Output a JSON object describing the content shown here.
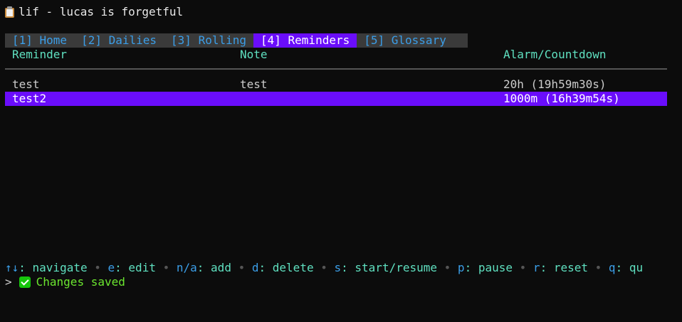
{
  "app": {
    "title": "lif - lucas is forgetful",
    "icon": "clipboard-icon"
  },
  "tabs": [
    {
      "label": "[1] Home",
      "active": false
    },
    {
      "label": "[2] Dailies",
      "active": false
    },
    {
      "label": "[3] Rolling",
      "active": false
    },
    {
      "label": "[4] Reminders",
      "active": true
    },
    {
      "label": "[5] Glossary",
      "active": false
    }
  ],
  "table": {
    "headers": {
      "reminder": "Reminder",
      "note": "Note",
      "alarm": "Alarm/Countdown"
    },
    "rows": [
      {
        "reminder": "test",
        "note": "test",
        "alarm": "20h (19h59m30s)",
        "selected": false
      },
      {
        "reminder": "test2",
        "note": "",
        "alarm": "1000m (16h39m54s)",
        "selected": true
      }
    ]
  },
  "help": {
    "items": [
      {
        "key": "↑↓",
        "action": ": navigate"
      },
      {
        "key": "e",
        "action": ": edit"
      },
      {
        "key": "n/a",
        "action": ": add"
      },
      {
        "key": "d",
        "action": ": delete"
      },
      {
        "key": "s",
        "action": ": start/resume"
      },
      {
        "key": "p",
        "action": ": pause"
      },
      {
        "key": "r",
        "action": ": reset"
      },
      {
        "key": "q",
        "action": ": qu"
      }
    ],
    "separator": "•"
  },
  "status": {
    "prompt": ">",
    "icon": "check-icon",
    "message": "Changes saved"
  },
  "colors": {
    "background": "#0c0c0c",
    "accent": "#6a0dfb",
    "tab_text": "#3b9ee8",
    "header_text": "#5fe0c0",
    "success": "#6be62f"
  }
}
